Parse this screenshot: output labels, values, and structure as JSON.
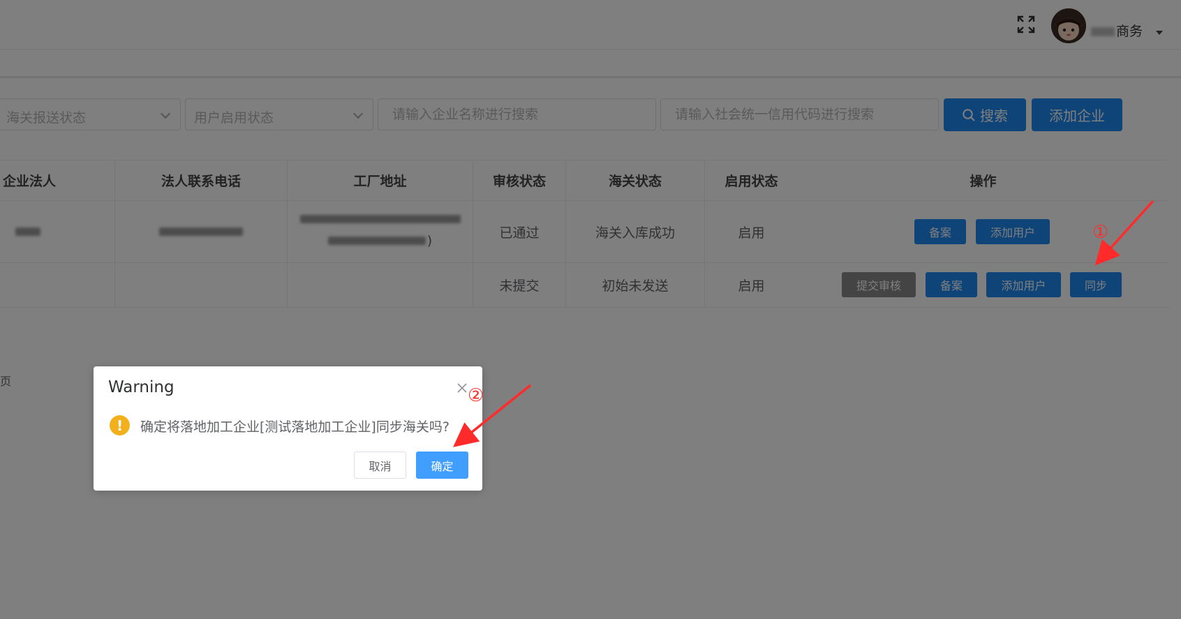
{
  "header": {
    "username_suffix": "商务",
    "fullscreen_icon": "fullscreen-icon",
    "avatar_icon": "avatar"
  },
  "filters": {
    "customs_status_placeholder": "海关报送状态",
    "user_status_placeholder": "用户启用状态",
    "company_name_placeholder": "请输入企业名称进行搜索",
    "credit_code_placeholder": "请输入社会统一信用代码进行搜索",
    "search_label": "搜索",
    "add_company_label": "添加企业"
  },
  "table": {
    "columns": [
      "企业法人",
      "法人联系电话",
      "工厂地址",
      "审核状态",
      "海关状态",
      "启用状态",
      "操作"
    ],
    "rows": [
      {
        "legal_person": "",
        "phone": "",
        "address_suffix": ")",
        "audit_status": "已通过",
        "customs_status": "海关入库成功",
        "enabled_status": "启用",
        "actions": [
          "备案",
          "添加用户"
        ]
      },
      {
        "legal_person": "",
        "phone": "",
        "address_suffix": "",
        "audit_status": "未提交",
        "customs_status": "初始未发送",
        "enabled_status": "启用",
        "actions": [
          "提交审核",
          "备案",
          "添加用户",
          "同步"
        ]
      }
    ]
  },
  "pager": {
    "text": "页"
  },
  "dialog": {
    "title": "Warning",
    "message": "确定将落地加工企业[测试落地加工企业]同步海关吗?",
    "cancel_label": "取消",
    "confirm_label": "确定"
  },
  "annotations": {
    "step1": "①",
    "step2": "②",
    "color": "#ff2b2b"
  }
}
